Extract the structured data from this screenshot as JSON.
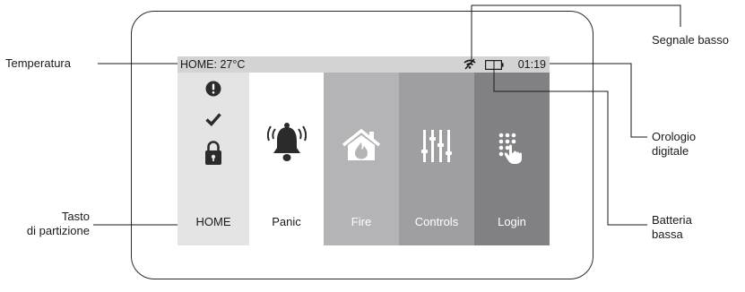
{
  "screen": {
    "status_bar": {
      "location_temperature": "HOME: 27°C",
      "clock": "01:19",
      "signal_icon": "signal-weak-icon",
      "battery_icon": "battery-low-icon"
    },
    "tiles": [
      {
        "label": "HOME",
        "icons": [
          "alert-icon",
          "check-icon",
          "lock-icon"
        ]
      },
      {
        "label": "Panic",
        "icon": "bell-alarm-icon"
      },
      {
        "label": "Fire",
        "icon": "house-fire-icon"
      },
      {
        "label": "Controls",
        "icon": "sliders-icon"
      },
      {
        "label": "Login",
        "icon": "keypad-touch-icon"
      }
    ]
  },
  "callouts": {
    "temperatura": "Temperatura",
    "tasto_line1": "Tasto",
    "tasto_line2": "di partizione",
    "segnale_basso": "Segnale basso",
    "orologio_line1": "Orologio",
    "orologio_line2": "digitale",
    "batteria_line1": "Batteria",
    "batteria_line2": "bassa"
  },
  "colors": {
    "status_bar": "#d3d3d3",
    "home_tile": "#e4e4e4",
    "panic_tile": "#ffffff",
    "fire_tile": "#b4b4b6",
    "controls_tile": "#9f9fa1",
    "login_tile": "#818184",
    "icon_dark": "#2b2b2b"
  }
}
